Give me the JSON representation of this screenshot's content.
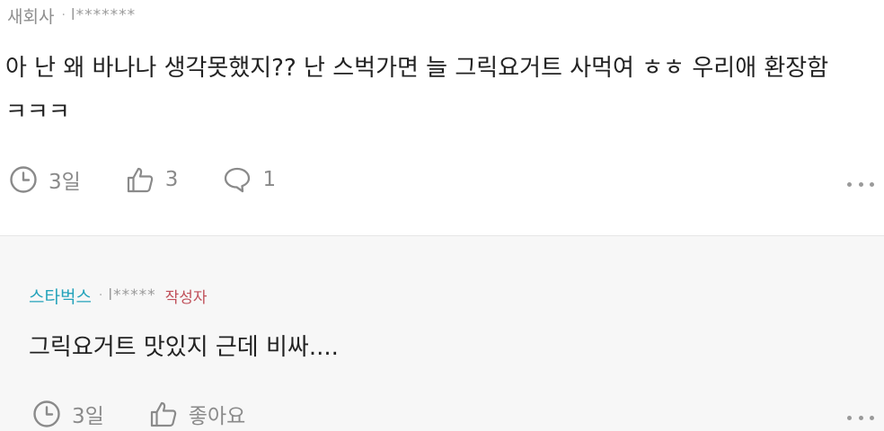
{
  "comment": {
    "author": "새회사",
    "separator": "·",
    "masked_name": "l*******",
    "text": "아 난 왜 바나나 생각못했지?? 난 스벅가면 늘 그릭요거트 사먹여 ㅎㅎ 우리애 환장함 ㅋㅋㅋ",
    "time": "3일",
    "like_count": "3",
    "reply_count": "1"
  },
  "reply": {
    "author": "스타벅스",
    "separator": "·",
    "masked_name": "l*****",
    "writer_badge": "작성자",
    "text": "그릭요거트 맛있지 근데 비싸....",
    "time": "3일",
    "like_label": "좋아요"
  },
  "icons": {
    "clock": "clock-icon",
    "like": "thumbs-up-icon",
    "reply": "speech-bubble-icon",
    "more": "more-dots-icon"
  },
  "colors": {
    "reply_author": "#24a3bb",
    "writer_badge": "#c0505a",
    "reply_background": "#f7f7f7",
    "meta_gray": "#8a8a8a"
  }
}
